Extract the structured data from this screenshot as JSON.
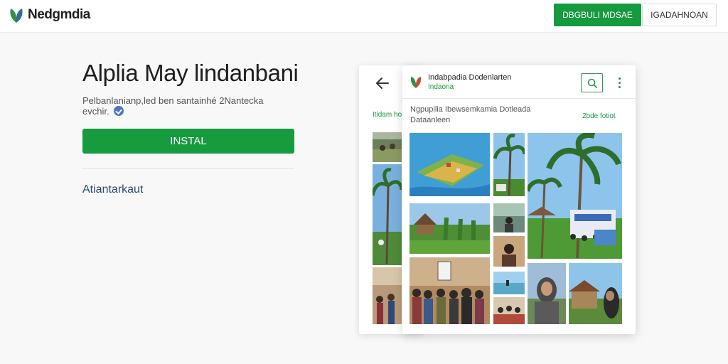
{
  "header": {
    "brand_name": "Nedgmdia",
    "primary_button": "DBGBULI MDSAE",
    "secondary_button": "IGADAHNOAN"
  },
  "hero": {
    "title": "Alplia May lindanbani",
    "description": "Pelbanlanianp,led ben santainhé 2Nantecka evchir.",
    "install_label": "INSTAL",
    "link_label": "Atiantarkaut"
  },
  "device": {
    "back_label": "Itidam ho",
    "front_title": "Indabpadia Dodenlarten",
    "front_subtitle": "Indaoria",
    "front_description": "Ngpupilia Ibewsemkamia Dotleada Dataanleen",
    "front_more": "2bde fotiot"
  },
  "colors": {
    "accent_green": "#159a3d",
    "link_blue": "#2a4c70",
    "verified_blue": "#4a76c8"
  },
  "icons": [
    "leaf-logo-icon",
    "verified-icon",
    "back-arrow-icon",
    "search-icon",
    "more-vert-icon"
  ]
}
